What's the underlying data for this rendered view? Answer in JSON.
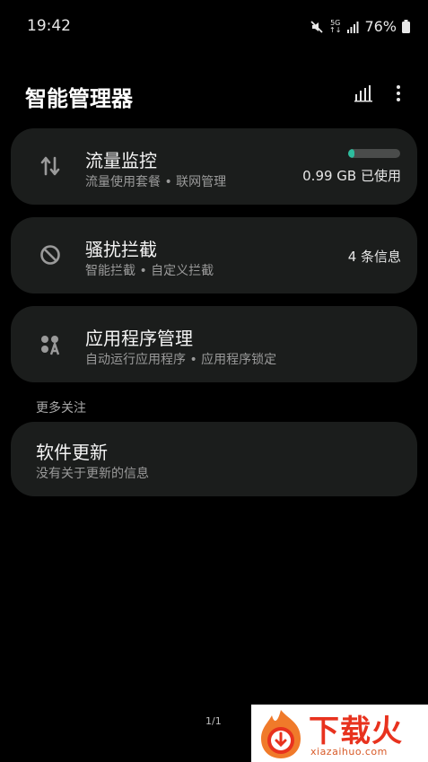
{
  "status_bar": {
    "time": "19:42",
    "network_label_top": "5G",
    "network_label_bottom": "↑↓",
    "battery_percent": "76%"
  },
  "header": {
    "title": "智能管理器"
  },
  "cards": [
    {
      "title": "流量监控",
      "subtitle": "流量使用套餐 • 联网管理",
      "right_text": "0.99 GB 已使用",
      "usage_fraction": 0.12,
      "icon": "data-transfer-icon"
    },
    {
      "title": "骚扰拦截",
      "subtitle": "智能拦截 • 自定义拦截",
      "right_text": "4 条信息",
      "icon": "block-icon"
    },
    {
      "title": "应用程序管理",
      "subtitle": "自动运行应用程序 • 应用程序锁定",
      "icon": "apps-icon"
    }
  ],
  "more": {
    "section_label": "更多关注",
    "software_update": {
      "title": "软件更新",
      "subtitle": "没有关于更新的信息"
    }
  },
  "page_indicator": "1/1",
  "watermark": {
    "name": "下载火",
    "url": "xiazaihuo.com"
  },
  "colors": {
    "background": "#000000",
    "card": "#1b1d1c",
    "accent": "#2dbd9e",
    "watermark": "#e8321e"
  }
}
